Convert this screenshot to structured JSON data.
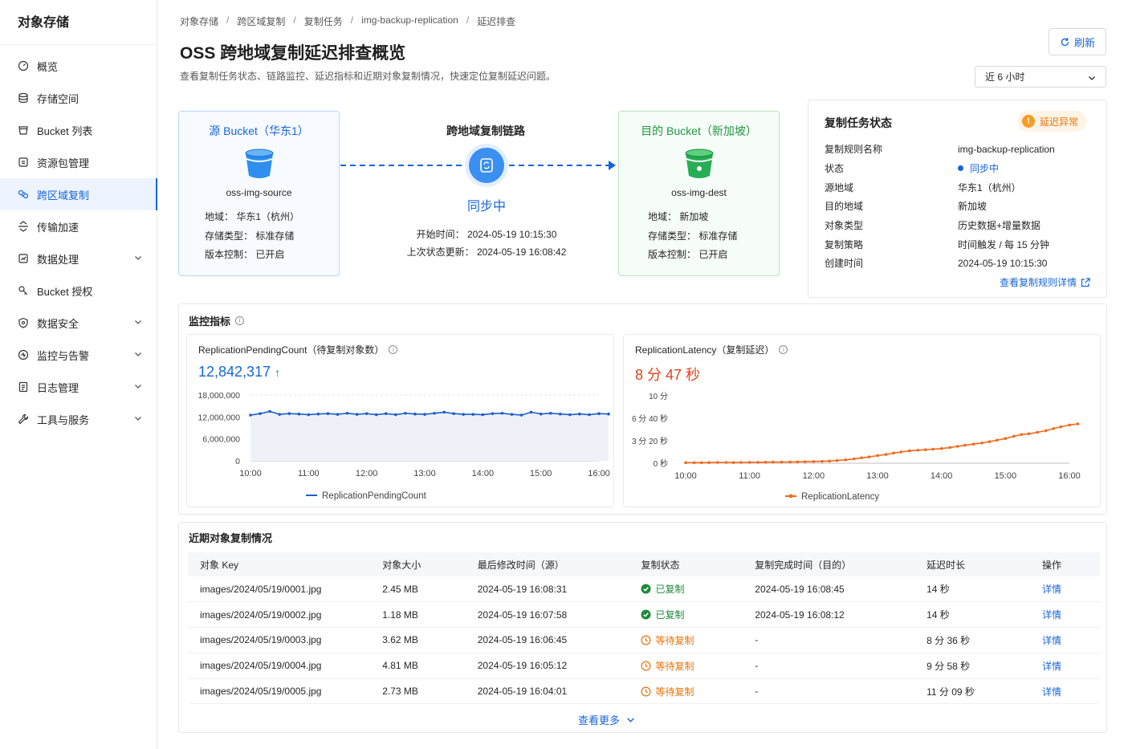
{
  "sidebar": {
    "title": "对象存储",
    "items": [
      {
        "label": "概览",
        "icon": "dashboard-icon"
      },
      {
        "label": "存储空间",
        "icon": "storage-icon"
      },
      {
        "label": "Bucket 列表",
        "icon": "bucket-icon"
      },
      {
        "label": "资源包管理",
        "icon": "package-icon"
      },
      {
        "label": "跨区域复制",
        "icon": "replication-icon",
        "active": true
      },
      {
        "label": "传输加速",
        "icon": "acceleration-icon"
      },
      {
        "label": "数据处理",
        "icon": "data-process-icon",
        "expandable": true
      },
      {
        "label": "Bucket 授权",
        "icon": "authorization-icon"
      },
      {
        "label": "数据安全",
        "icon": "shield-icon",
        "expandable": true
      },
      {
        "label": "监控与告警",
        "icon": "monitor-icon",
        "expandable": true
      },
      {
        "label": "日志管理",
        "icon": "log-icon",
        "expandable": true
      },
      {
        "label": "工具与服务",
        "icon": "tool-icon",
        "expandable": true
      }
    ]
  },
  "breadcrumb": [
    "对象存储",
    "跨区域复制",
    "复制任务",
    "img-backup-replication",
    "延迟排查"
  ],
  "page": {
    "title": "OSS 跨地域复制延迟排查概览",
    "subtitle": "查看复制任务状态、链路监控、延迟指标和近期对象复制情况，快速定位复制延迟问题。",
    "refresh_label": "刷新",
    "time_range": "近 6 小时"
  },
  "source_bucket": {
    "title": "源 Bucket（华东1）",
    "name": "oss-img-source",
    "region": "地域：  华东1（杭州）",
    "storage": "存储类型：  标准存储",
    "versioning": "版本控制：  已开启"
  },
  "link": {
    "title": "跨地域复制链路",
    "status": "同步中",
    "start_time": "开始时间：  2024-05-19 10:15:30",
    "last_update": "上次状态更新：  2024-05-19 16:08:42"
  },
  "dest_bucket": {
    "title": "目的 Bucket（新加坡）",
    "name": "oss-img-dest",
    "region": "地域：  新加坡",
    "storage": "存储类型：  标准存储",
    "versioning": "版本控制：  已开启"
  },
  "task_status": {
    "title": "复制任务状态",
    "badge": "延迟异常",
    "rows": [
      {
        "key": "复制规则名称",
        "value": "img-backup-replication"
      },
      {
        "key": "状态",
        "value": "同步中"
      },
      {
        "key": "源地域",
        "value": "华东1（杭州）"
      },
      {
        "key": "目的地域",
        "value": "新加坡"
      },
      {
        "key": "对象类型",
        "value": "历史数据+增量数据"
      },
      {
        "key": "复制策略",
        "value": "时间触发 / 每 15 分钟"
      },
      {
        "key": "创建时间",
        "value": "2024-05-19 10:15:30"
      }
    ],
    "detail_link": "查看复制规则详情"
  },
  "monitor": {
    "title": "监控指标",
    "pending": {
      "title": "ReplicationPendingCount（待复制对象数）",
      "value": "12,842,317",
      "trend": "↑"
    },
    "latency": {
      "title": "ReplicationLatency（复制延迟）",
      "value": "8 分 47 秒"
    }
  },
  "chart_data": [
    {
      "type": "line",
      "title": "ReplicationPendingCount（待复制对象数）",
      "x_ticks": [
        "10:00",
        "11:00",
        "12:00",
        "13:00",
        "14:00",
        "15:00",
        "16:00"
      ],
      "y_ticks": [
        "18,000,000",
        "12,000,000",
        "6,000,000",
        "0"
      ],
      "ylim": [
        0,
        18000000
      ],
      "grid": true,
      "legend": "bottom-center",
      "series": [
        {
          "name": "ReplicationPendingCount",
          "color": "#1f5fc8",
          "x_minutes": [
            0,
            10,
            20,
            30,
            40,
            50,
            60,
            70,
            80,
            90,
            100,
            110,
            120,
            130,
            140,
            150,
            160,
            170,
            180,
            190,
            200,
            210,
            220,
            230,
            240,
            250,
            260,
            270,
            280,
            290,
            300,
            310,
            320,
            330,
            340,
            350,
            360,
            370
          ],
          "values": [
            12500000,
            12900000,
            13500000,
            12700000,
            12900000,
            12800000,
            12600000,
            12800000,
            12900000,
            12700000,
            13000000,
            12700000,
            12900000,
            12600000,
            12900000,
            12600000,
            13000000,
            12800000,
            12700000,
            13000000,
            13300000,
            12900000,
            12700000,
            12700000,
            12600000,
            12900000,
            13000000,
            12700000,
            12500000,
            13300000,
            12800000,
            13000000,
            12800000,
            12600000,
            12800000,
            12600000,
            12900000,
            12800000
          ]
        }
      ]
    },
    {
      "type": "line",
      "title": "ReplicationLatency（复制延迟）",
      "x_ticks": [
        "10:00",
        "11:00",
        "12:00",
        "13:00",
        "14:00",
        "15:00",
        "16:00"
      ],
      "y_ticks": [
        "10 分",
        "6 分 40 秒",
        "3 分 20 秒",
        "0 秒"
      ],
      "ylim_seconds": [
        0,
        600
      ],
      "grid": false,
      "legend": "bottom-center",
      "series": [
        {
          "name": "ReplicationLatency",
          "color": "#f06a1c",
          "x_minutes": [
            0,
            8,
            15,
            22,
            30,
            38,
            45,
            52,
            60,
            68,
            75,
            82,
            90,
            98,
            105,
            112,
            120,
            128,
            135,
            142,
            150,
            158,
            165,
            172,
            180,
            188,
            195,
            202,
            210,
            218,
            225,
            232,
            240,
            248,
            255,
            262,
            270,
            278,
            285,
            292,
            300,
            308,
            315,
            322,
            330,
            338,
            345,
            352,
            360,
            368
          ],
          "seconds_values": [
            5,
            5,
            5,
            6,
            7,
            7,
            6,
            7,
            8,
            8,
            9,
            10,
            10,
            11,
            12,
            13,
            15,
            17,
            19,
            24,
            30,
            38,
            48,
            56,
            68,
            78,
            90,
            100,
            110,
            116,
            120,
            125,
            130,
            140,
            150,
            160,
            170,
            180,
            192,
            205,
            220,
            240,
            255,
            262,
            275,
            290,
            308,
            324,
            340,
            350
          ]
        }
      ]
    }
  ],
  "recent": {
    "title": "近期对象复制情况",
    "columns": [
      "对象 Key",
      "对象大小",
      "最后修改时间（源）",
      "复制状态",
      "复制完成时间（目的）",
      "延迟时长",
      "操作"
    ],
    "rows": [
      {
        "key": "images/2024/05/19/0001.jpg",
        "size": "2.45 MB",
        "modified": "2024-05-19 16:08:31",
        "status": "已复制",
        "status_type": "ok",
        "done": "2024-05-19 16:08:45",
        "delay": "14 秒",
        "action": "详情"
      },
      {
        "key": "images/2024/05/19/0002.jpg",
        "size": "1.18 MB",
        "modified": "2024-05-19 16:07:58",
        "status": "已复制",
        "status_type": "ok",
        "done": "2024-05-19 16:08:12",
        "delay": "14 秒",
        "action": "详情"
      },
      {
        "key": "images/2024/05/19/0003.jpg",
        "size": "3.62 MB",
        "modified": "2024-05-19 16:06:45",
        "status": "等待复制",
        "status_type": "wait",
        "done": "-",
        "delay": "8 分 36 秒",
        "action": "详情"
      },
      {
        "key": "images/2024/05/19/0004.jpg",
        "size": "4.81 MB",
        "modified": "2024-05-19 16:05:12",
        "status": "等待复制",
        "status_type": "wait",
        "done": "-",
        "delay": "9 分 58 秒",
        "action": "详情"
      },
      {
        "key": "images/2024/05/19/0005.jpg",
        "size": "2.73 MB",
        "modified": "2024-05-19 16:04:01",
        "status": "等待复制",
        "status_type": "wait",
        "done": "-",
        "delay": "11 分 09 秒",
        "action": "详情"
      }
    ],
    "view_more": "查看更多"
  },
  "colors": {
    "accent": "#1765d9",
    "success": "#1f8a3c",
    "warning": "#e8730a",
    "latency": "#f06a1c"
  }
}
